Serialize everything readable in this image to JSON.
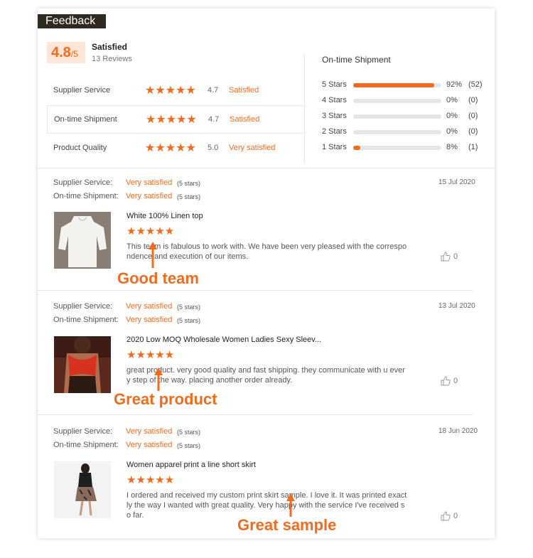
{
  "header": {
    "title": "Feedback"
  },
  "summary": {
    "score": "4.8",
    "score_suffix": "/5",
    "label": "Satisfied",
    "reviews": "13 Reviews"
  },
  "ratings": [
    {
      "label": "Supplier Service",
      "stars": "★★★★★",
      "value": "4.7",
      "text": "Satisfied"
    },
    {
      "label": "On-time Shipment",
      "stars": "★★★★★",
      "value": "4.7",
      "text": "Satisfied"
    },
    {
      "label": "Product Quality",
      "stars": "★★★★★",
      "value": "5.0",
      "text": "Very satisfied"
    }
  ],
  "distribution": {
    "title": "On-time Shipment",
    "rows": [
      {
        "label": "5 Stars",
        "fraction": 0.92,
        "pct": "92%",
        "count": "(52)"
      },
      {
        "label": "4 Stars",
        "fraction": 0,
        "pct": "0%",
        "count": "(0)"
      },
      {
        "label": "3 Stars",
        "fraction": 0,
        "pct": "0%",
        "count": "(0)"
      },
      {
        "label": "2 Stars",
        "fraction": 0,
        "pct": "0%",
        "count": "(0)"
      },
      {
        "label": "1 Stars",
        "fraction": 0.08,
        "pct": "8%",
        "count": "(1)"
      }
    ]
  },
  "reviews": [
    {
      "supplier_label": "Supplier Service:",
      "supplier_value": "Very satisfied",
      "supplier_stars": "(5 stars)",
      "shipment_label": "On-time Shipment:",
      "shipment_value": "Very satisfied",
      "shipment_stars": "(5 stars)",
      "date": "15 Jul 2020",
      "product": "White 100% Linen top",
      "stars": "★★★★★",
      "text": "This team is fabulous to work with. We have been very pleased with the correspondence and execution of our items.",
      "likes": "0",
      "annotation": "Good team"
    },
    {
      "supplier_label": "Supplier Service:",
      "supplier_value": "Very satisfied",
      "supplier_stars": "(5 stars)",
      "shipment_label": "On-time Shipment:",
      "shipment_value": "Very satisfied",
      "shipment_stars": "(5 stars)",
      "date": "13 Jul 2020",
      "product": "2020 Low MOQ Wholesale Women Ladies Sexy Sleev...",
      "stars": "★★★★★",
      "text": "great product. very good quality and fast shipping. they communicate with u every step of the way. placing another order already.",
      "likes": "0",
      "annotation": "Great product"
    },
    {
      "supplier_label": "Supplier Service:",
      "supplier_value": "Very satisfied",
      "supplier_stars": "(5 stars)",
      "shipment_label": "On-time Shipment:",
      "shipment_value": "Very satisfied",
      "shipment_stars": "(5 stars)",
      "date": "18 Jun 2020",
      "product": "Women apparel print a line short skirt",
      "stars": "★★★★★",
      "text": "I ordered and received my custom print skirt sample. I love it. It was printed exactly the way I wanted with great quality. Very happy with the service I've received so far.",
      "likes": "0",
      "annotation": "Great sample"
    }
  ],
  "colors": {
    "accent": "#f26a1b",
    "title_bg": "#2f2a20",
    "score_bg": "#fde6d7"
  }
}
